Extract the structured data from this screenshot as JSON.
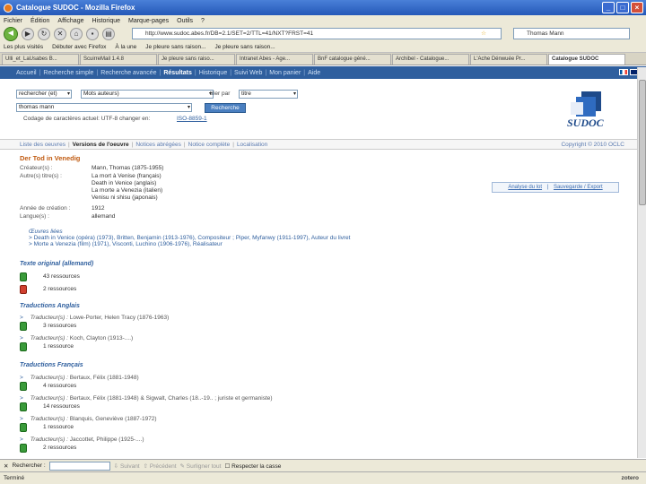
{
  "window": {
    "title": "Catalogue SUDOC - Mozilla Firefox"
  },
  "menu": [
    "Fichier",
    "Édition",
    "Affichage",
    "Historique",
    "Marque-pages",
    "Outils",
    "?"
  ],
  "toolbar": {
    "url": "http://www.sudoc.abes.fr/DB=2.1/SET=2/TTL=41/NXT?FRST=41",
    "search_value": "Thomas Mann"
  },
  "bookmarks": [
    "Les plus visités",
    "Débuter avec Firefox",
    "À la une",
    "Je pleure sans raison...",
    "Je pleure sans raison..."
  ],
  "tabs": [
    {
      "label": "Ulli_et_LaUsabes B...",
      "active": false
    },
    {
      "label": "ScuirreMail 1.4.8",
      "active": false
    },
    {
      "label": "Je pleure sans raiso...",
      "active": false
    },
    {
      "label": "Intranet Abes - Age...",
      "active": false
    },
    {
      "label": "BnF catalogue géné...",
      "active": false
    },
    {
      "label": "Archibel - Catalogue...",
      "active": false
    },
    {
      "label": "L'Ache Dénwuée Pr...",
      "active": false
    },
    {
      "label": "Catalogue SUDOC",
      "active": true
    }
  ],
  "sitenav": {
    "items": [
      "Accueil",
      "Recherche simple",
      "Recherche avancée",
      "Résultats",
      "Historique",
      "Suivi Web",
      "Mon panier",
      "Aide"
    ],
    "active_index": 3
  },
  "search": {
    "scope": "rechercher (et)",
    "index": "Mots auteurs)",
    "sort_label": "trier par",
    "sort_value": "titre",
    "query": "thomas mann",
    "button": "Recherche",
    "charset_note": "Codage de caractères actuel: UTF-8   changer en:",
    "charset_link": "ISO-8859-1"
  },
  "logo": {
    "text": "SUDOC"
  },
  "subnav": {
    "items": [
      "Liste des oeuvres",
      "Versions de l'oeuvre",
      "Notices abrégées",
      "Notice complète",
      "Localisation"
    ],
    "active_index": 1,
    "copyright": "Copyright © 2010 OCLC"
  },
  "record": {
    "title": "Der Tod in Venedig",
    "fields": [
      {
        "label": "Créateur(s) :",
        "value": "Mann, Thomas (1875-1955)"
      },
      {
        "label": "Autre(s) titre(s) :",
        "value": "La mort à Venise (français)"
      },
      {
        "label": "",
        "value": "Death in Venice (anglais)"
      },
      {
        "label": "",
        "value": "La morte a Venezia (italien)"
      },
      {
        "label": "",
        "value": "Venisu ni shisu (japonais)"
      },
      {
        "label": "Année de création :",
        "value": "1912"
      },
      {
        "label": "Langue(s) :",
        "value": "allemand"
      }
    ],
    "side_buttons": {
      "analyse": "Analyse du lot",
      "save": "Sauvegarde / Export"
    },
    "related_title": "Œuvres liées",
    "related": [
      "Death in Venice (opéra) (1973), Britten, Benjamin (1913-1976), Compositeur ; Piper, Myfanwy (1911-1997), Auteur du livret",
      "Morte a Venezia (film) (1971), Visconti, Luchino (1906-1976), Réalisateur"
    ]
  },
  "sections": [
    {
      "title": "Texte original (allemand)"
    },
    {
      "title": "Traductions Anglais"
    },
    {
      "title": "Traductions Français"
    }
  ],
  "resources": {
    "orig_1": "43 ressources",
    "orig_2": "2 ressources",
    "en_1": "3 ressources",
    "en_2": "1 ressource",
    "fr_1": "4 ressources",
    "fr_2": "14 ressources",
    "fr_3": "1 ressource",
    "fr_4": "2 ressources"
  },
  "translators": {
    "en_1": "Lowe-Porter, Helen Tracy (1876-1963)",
    "en_2": "Koch, Clayton (1913-....)",
    "fr_1": "Bertaux, Félix (1881-1948)",
    "fr_2": "Bertaux, Félix (1881-1948) & Sigwalt, Charles (18..-19.. ; juriste et germaniste)",
    "fr_3": "Blanquis, Geneviève (1887-1972)",
    "fr_4": "Jaccottet, Philippe (1925-....)",
    "prefix": "Traducteur(s) :"
  },
  "findbar": {
    "label": "Rechercher :",
    "next": "Suivant",
    "prev": "Précédent",
    "highlight": "Surligner tout",
    "match_case": "Respecter la casse"
  },
  "status": {
    "text": "Terminé",
    "zotero": "zotero"
  }
}
